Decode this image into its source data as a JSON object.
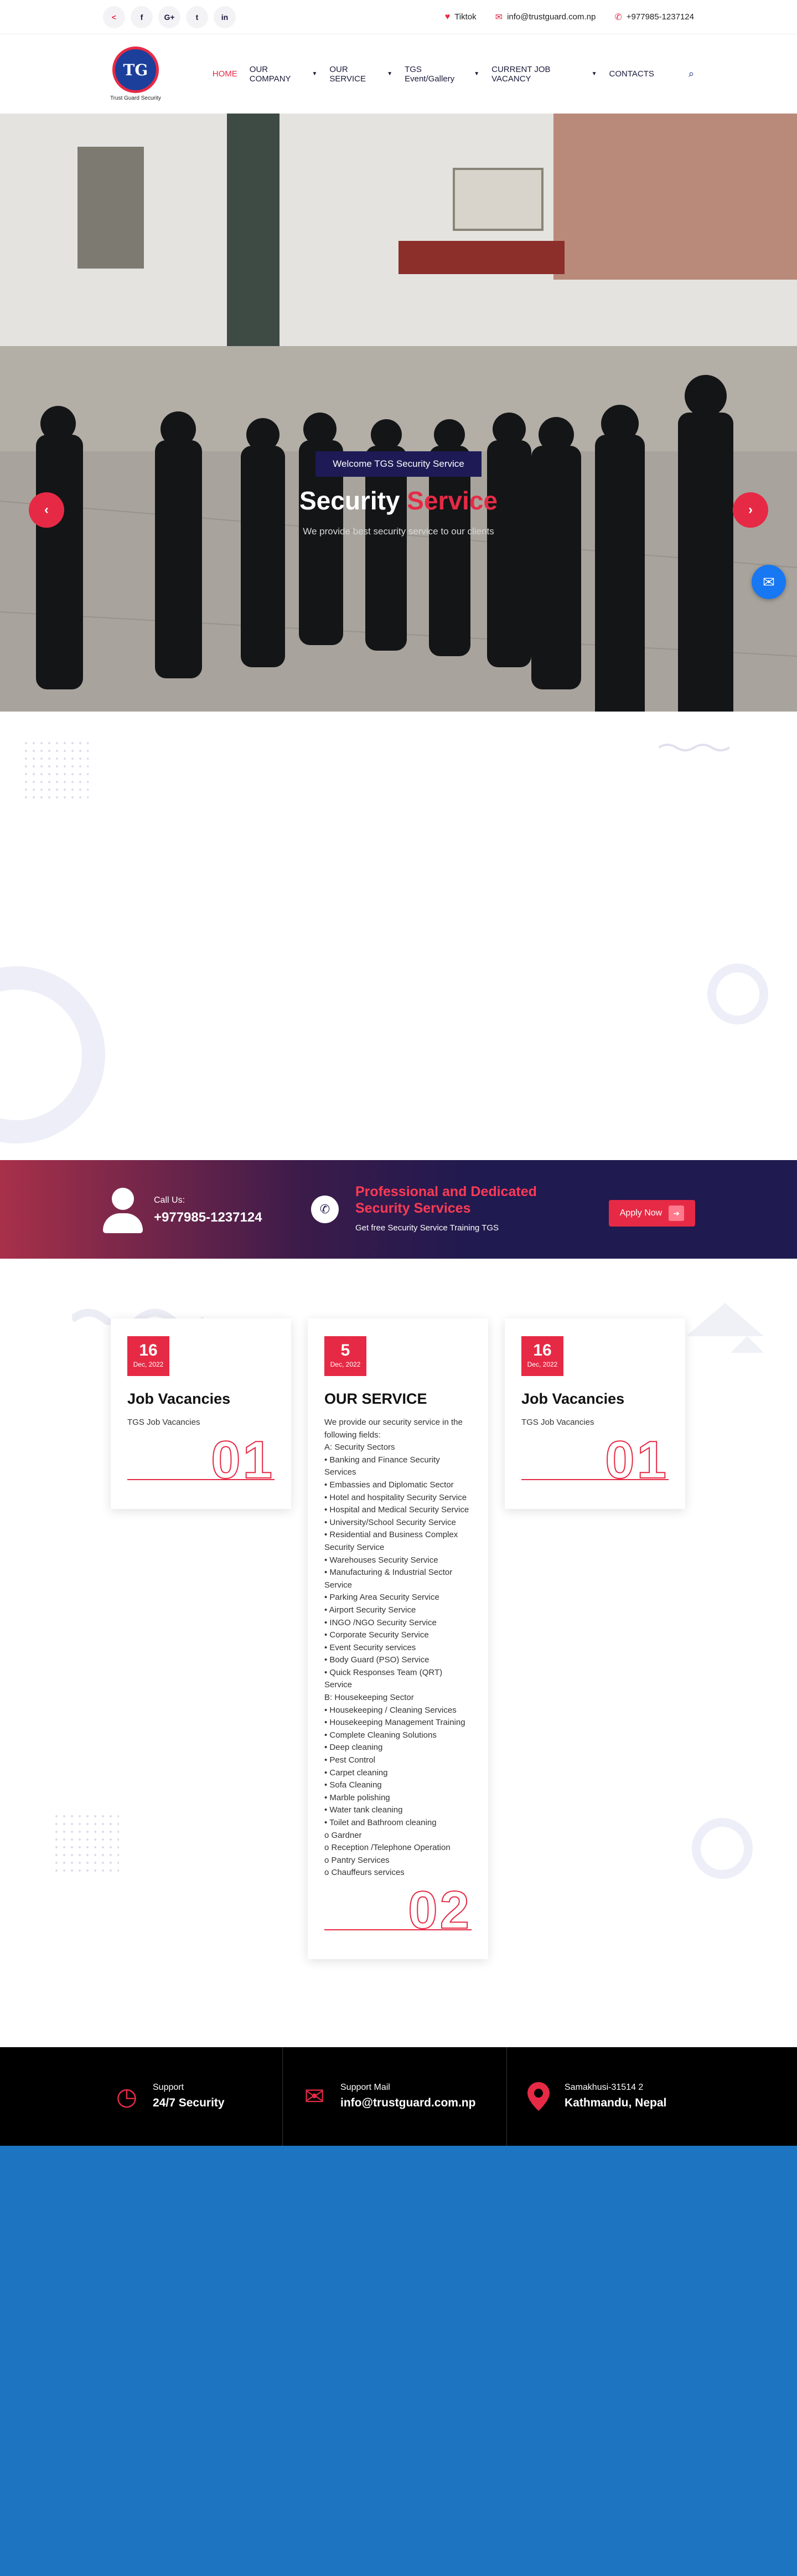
{
  "topbar": {
    "social": [
      {
        "icon": "share-icon",
        "glyph": "<"
      },
      {
        "icon": "facebook-icon",
        "glyph": "f"
      },
      {
        "icon": "google-plus-icon",
        "glyph": "G+"
      },
      {
        "icon": "twitter-icon",
        "glyph": "t"
      },
      {
        "icon": "linkedin-icon",
        "glyph": "in"
      }
    ],
    "tiktok": "Tiktok",
    "email": "info@trustguard.com.np",
    "phone": "+977985-1237124"
  },
  "nav": {
    "logo_text": "Trust Guard Security",
    "logo_mark": "TG",
    "items": [
      {
        "label": "HOME",
        "active": true,
        "dropdown": false
      },
      {
        "label": "OUR COMPANY",
        "active": false,
        "dropdown": true
      },
      {
        "label": "OUR SERVICE",
        "active": false,
        "dropdown": true
      },
      {
        "label": "TGS Event/Gallery",
        "active": false,
        "dropdown": true
      },
      {
        "label": "CURRENT JOB VACANCY",
        "active": false,
        "dropdown": true
      },
      {
        "label": "CONTACTS",
        "active": false,
        "dropdown": false
      }
    ]
  },
  "hero": {
    "badge": "Welcome TGS Security Service",
    "title_main": "Security ",
    "title_accent": "Service",
    "subtitle": "We provide best security service to our clients",
    "prev": "‹",
    "next": "›"
  },
  "cta": {
    "call_label": "Call Us:",
    "call_number": "+977985-1237124",
    "heading": "Professional and Dedicated Security Services",
    "subtext": "Get free Security Service Training TGS",
    "apply_label": "Apply Now"
  },
  "cards": [
    {
      "day": "16",
      "month": "Dec, 2022",
      "title": "Job Vacancies",
      "body": "TGS Job Vacancies",
      "num": "01"
    },
    {
      "day": "5",
      "month": "Dec, 2022",
      "title": "OUR SERVICE",
      "body": "We provide our security service in the following fields:\nA: Security Sectors\n• Banking and Finance Security Services\n• Embassies and Diplomatic Sector\n• Hotel and hospitality Security Service\n• Hospital and Medical Security Service\n• University/School Security Service\n• Residential and Business Complex Security Service\n• Warehouses Security Service\n• Manufacturing & Industrial Sector Service\n• Parking Area Security Service\n• Airport Security Service\n• INGO /NGO Security Service\n• Corporate Security Service\n• Event Security services\n• Body Guard (PSO) Service\n• Quick Responses Team (QRT) Service\nB: Housekeeping Sector\n• Housekeeping / Cleaning Services\n• Housekeeping Management Training\n• Complete Cleaning Solutions\n• Deep cleaning\n• Pest Control\n• Carpet cleaning\n• Sofa Cleaning\n• Marble polishing\n• Water tank cleaning\n• Toilet and Bathroom cleaning\no Gardner\no Reception /Telephone Operation\no Pantry Services\no Chauffeurs services",
      "num": "02"
    },
    {
      "day": "16",
      "month": "Dec, 2022",
      "title": "Job Vacancies",
      "body": "TGS Job Vacancies",
      "num": "01"
    }
  ],
  "info": [
    {
      "icon": "clock-icon",
      "glyph": "◷",
      "label": "Support",
      "value": "24/7 Security"
    },
    {
      "icon": "mail-icon",
      "glyph": "✉",
      "label": "Support Mail",
      "value": "info@trustguard.com.np"
    },
    {
      "icon": "location-pin-icon",
      "glyph": "⬤",
      "label": "Samakhusi-31514 2",
      "value": "Kathmandu, Nepal"
    }
  ],
  "colors": {
    "accent": "#e62a45",
    "navy": "#1f1a4f",
    "footer_blue": "#1d74c1"
  }
}
